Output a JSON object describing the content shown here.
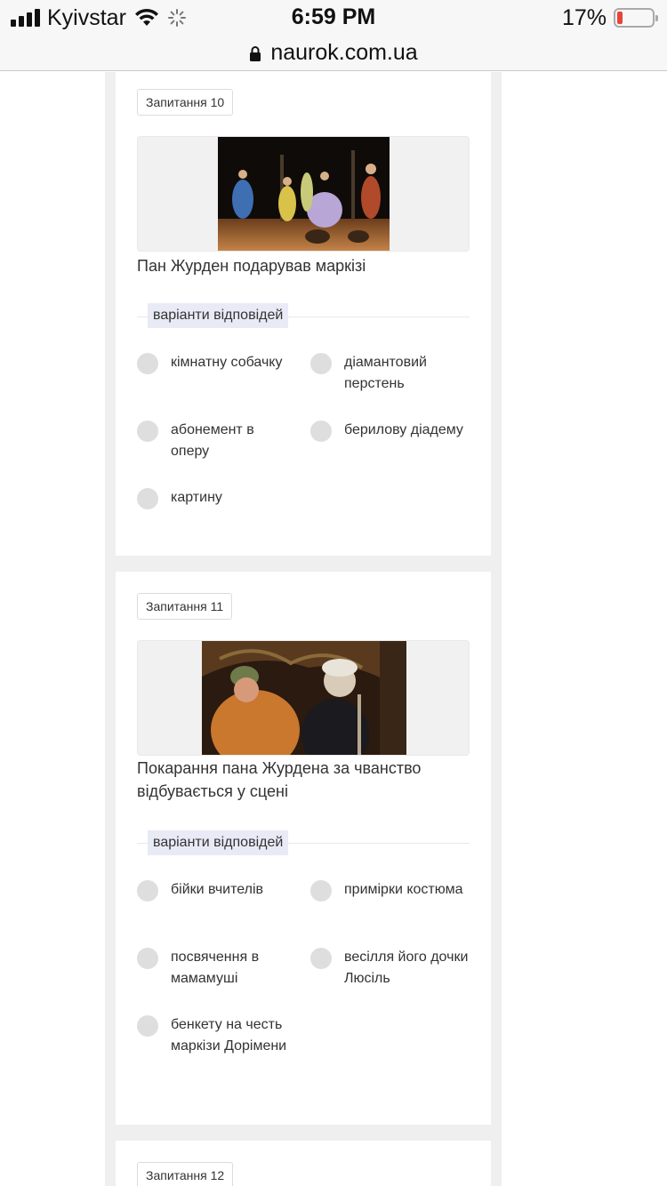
{
  "statusbar": {
    "carrier": "Kyivstar",
    "time": "6:59 PM",
    "battery": "17%",
    "battery_level": 0.17
  },
  "browser": {
    "url": "naurok.com.ua"
  },
  "questions": [
    {
      "badge": "Запитання 10",
      "text": "Пан Журден подарував маркізі",
      "variants_label": "варіанти відповідей",
      "options": [
        "кімнатну собачку",
        "діамантовий перстень",
        "абонемент в оперу",
        "берилову діадему",
        "картину"
      ]
    },
    {
      "badge": "Запитання 11",
      "text": "Покарання пана Журдена за чванство відбувається у сцені",
      "variants_label": "варіанти відповідей",
      "options": [
        "бійки вчителів",
        "примірки костюма",
        "посвячення в мамамуші",
        "весілля його дочки Люсіль",
        "бенкету на честь маркізи Дорімени"
      ]
    },
    {
      "badge": "Запитання 12"
    }
  ]
}
